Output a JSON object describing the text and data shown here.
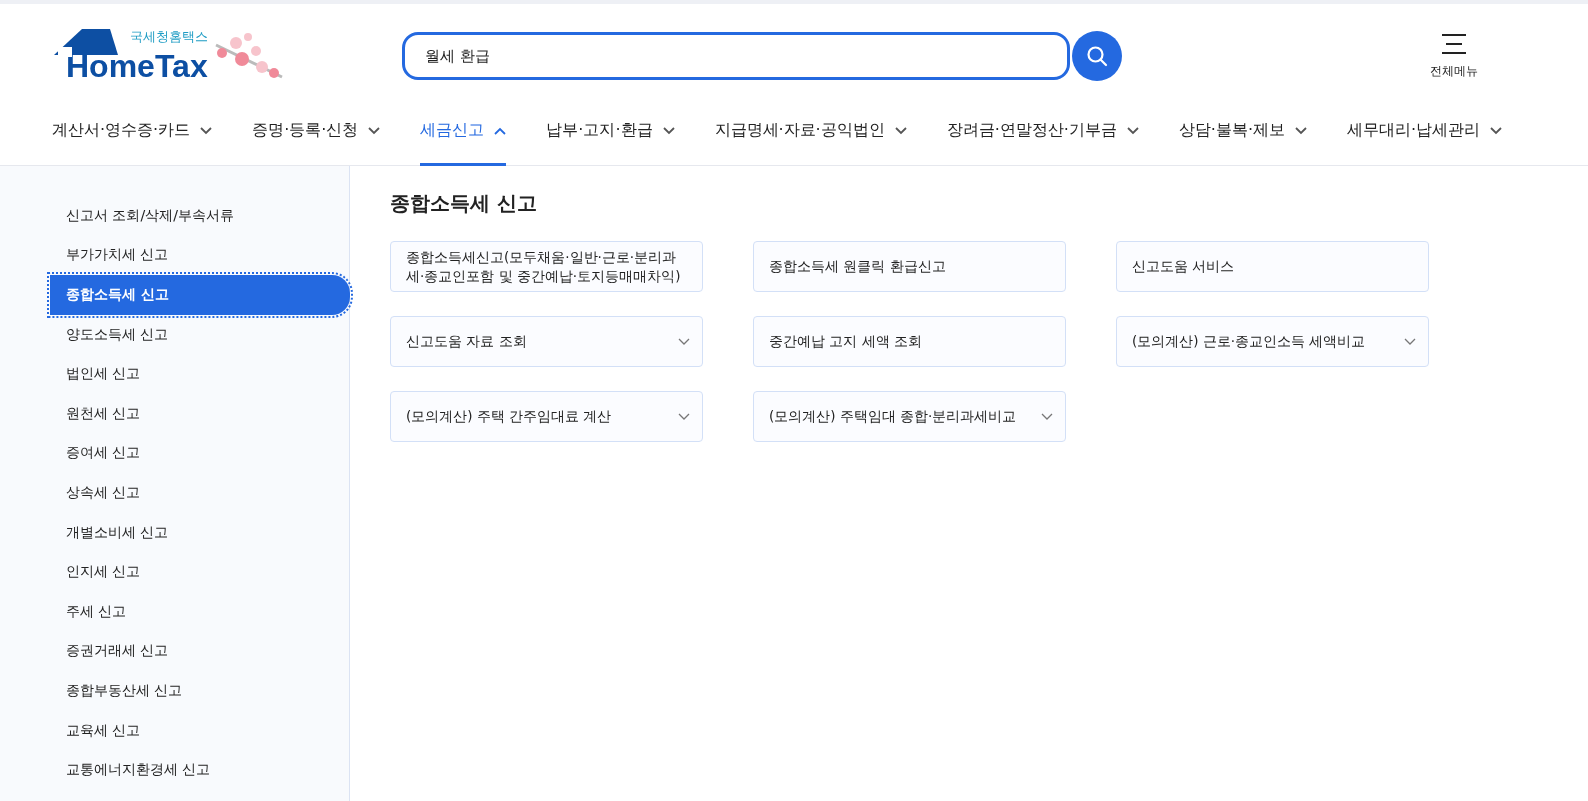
{
  "logo": {
    "subtitle": "국세청홈택스",
    "wordmark": "HomeTax"
  },
  "search": {
    "value": "월세 환급"
  },
  "all_menu": {
    "label": "전체메뉴"
  },
  "nav": [
    {
      "label": "계산서·영수증·카드",
      "selected": false
    },
    {
      "label": "증명·등록·신청",
      "selected": false
    },
    {
      "label": "세금신고",
      "selected": true
    },
    {
      "label": "납부·고지·환급",
      "selected": false
    },
    {
      "label": "지급명세·자료·공익법인",
      "selected": false
    },
    {
      "label": "장려금·연말정산·기부금",
      "selected": false
    },
    {
      "label": "상담·불복·제보",
      "selected": false
    },
    {
      "label": "세무대리·납세관리",
      "selected": false
    }
  ],
  "sidebar": {
    "items": [
      {
        "label": "신고서 조회/삭제/부속서류",
        "selected": false
      },
      {
        "label": "부가가치세 신고",
        "selected": false
      },
      {
        "label": "종합소득세 신고",
        "selected": true
      },
      {
        "label": "양도소득세 신고",
        "selected": false
      },
      {
        "label": "법인세 신고",
        "selected": false
      },
      {
        "label": "원천세 신고",
        "selected": false
      },
      {
        "label": "증여세 신고",
        "selected": false
      },
      {
        "label": "상속세 신고",
        "selected": false
      },
      {
        "label": "개별소비세 신고",
        "selected": false
      },
      {
        "label": "인지세 신고",
        "selected": false
      },
      {
        "label": "주세 신고",
        "selected": false
      },
      {
        "label": "증권거래세 신고",
        "selected": false
      },
      {
        "label": "종합부동산세 신고",
        "selected": false
      },
      {
        "label": "교육세 신고",
        "selected": false
      },
      {
        "label": "교통에너지환경세 신고",
        "selected": false
      }
    ]
  },
  "content": {
    "title": "종합소득세 신고",
    "cards": [
      {
        "label": "종합소득세신고(모두채움·일반·근로·분리과세·종교인포함 및 중간예납·토지등매매차익)",
        "expandable": false
      },
      {
        "label": "종합소득세 원클릭 환급신고",
        "expandable": false
      },
      {
        "label": "신고도움 서비스",
        "expandable": false
      },
      {
        "label": "신고도움 자료 조회",
        "expandable": true
      },
      {
        "label": "중간예납 고지 세액 조회",
        "expandable": false
      },
      {
        "label": "(모의계산) 근로·종교인소득 세액비교",
        "expandable": true
      },
      {
        "label": "(모의계산) 주택 간주임대료 계산",
        "expandable": true
      },
      {
        "label": "(모의계산) 주택임대 종합·분리과세비교",
        "expandable": true
      }
    ]
  }
}
